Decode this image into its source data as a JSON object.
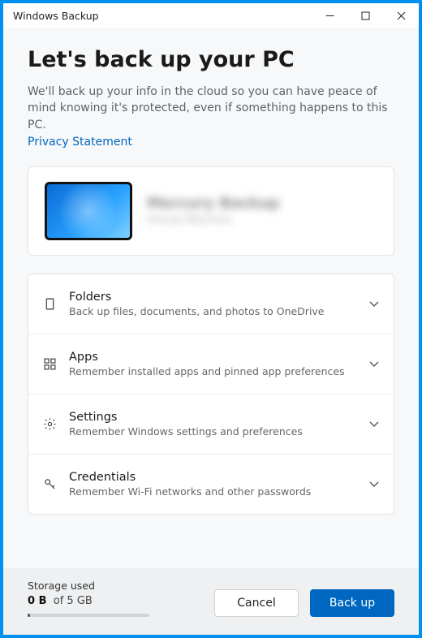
{
  "window": {
    "title": "Windows Backup"
  },
  "header": {
    "heading": "Let's back up your PC",
    "subtext": "We'll back up your info in the cloud so you can have peace of mind knowing it's protected, even if something happens to this PC.",
    "privacy_link": "Privacy Statement"
  },
  "device": {
    "name": "Mercury Backup",
    "subtitle": "Virtual Machine"
  },
  "sections": [
    {
      "icon": "folder-icon",
      "title": "Folders",
      "desc": "Back up files, documents, and photos to OneDrive"
    },
    {
      "icon": "apps-icon",
      "title": "Apps",
      "desc": "Remember installed apps and pinned app preferences"
    },
    {
      "icon": "gear-icon",
      "title": "Settings",
      "desc": "Remember Windows settings and preferences"
    },
    {
      "icon": "key-icon",
      "title": "Credentials",
      "desc": "Remember Wi-Fi networks and other passwords"
    }
  ],
  "storage": {
    "label": "Storage used",
    "used": "0 B",
    "of_word": "of",
    "total": "5 GB",
    "percent": 0
  },
  "buttons": {
    "cancel": "Cancel",
    "backup": "Back up"
  }
}
